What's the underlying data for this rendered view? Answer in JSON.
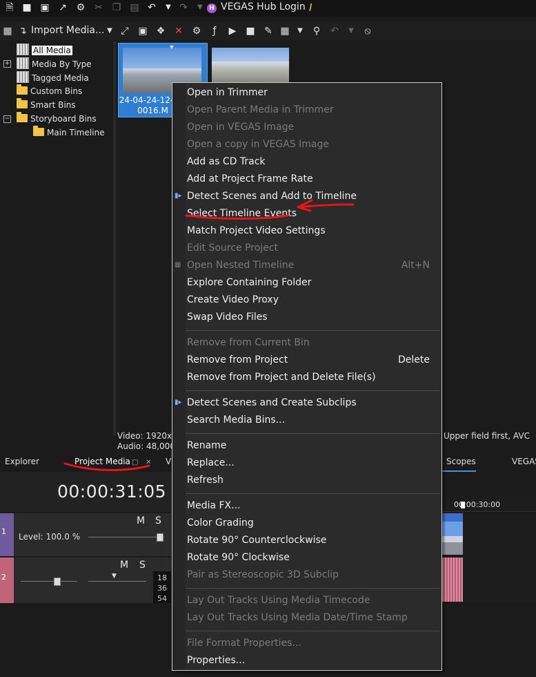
{
  "window": {
    "title": "VEGAS Hub Login",
    "hub_badge": "H",
    "title_icons": [
      "new-file-icon",
      "open-folder-icon",
      "save-icon",
      "external-icon",
      "gear-icon",
      "cut-icon",
      "copy-icon",
      "paste-icon",
      "undo-icon",
      "dropdown-icon",
      "redo-icon",
      "dropdown-icon"
    ]
  },
  "toolbar": {
    "import_label": "Import Media...",
    "icons": [
      "media-window-icon",
      "import-icon",
      "dropdown-icon",
      "trim-icon",
      "capture-icon",
      "proxy-icon",
      "delete-icon",
      "properties-icon",
      "fx-icon",
      "play-icon",
      "stop-icon",
      "auto-preview-icon",
      "views-icon",
      "search-icon",
      "undo-icon",
      "clear-icon"
    ]
  },
  "tree": {
    "items": [
      {
        "label": "All Media",
        "icon": "media-icon",
        "selected": true
      },
      {
        "label": "Media By Type",
        "icon": "media-icon",
        "expander": "+"
      },
      {
        "label": "Tagged Media",
        "icon": "media-icon"
      },
      {
        "label": "Custom Bins",
        "icon": "folder-icon"
      },
      {
        "label": "Smart Bins",
        "icon": "folder-icon"
      },
      {
        "label": "Storyboard Bins",
        "icon": "folder-icon",
        "expander": "−"
      },
      {
        "label": "Main Timeline",
        "icon": "folder-icon"
      }
    ]
  },
  "media": {
    "thumb1_label": "24-04-24-12-     0016.M",
    "info_video": "Video: 1920x1",
    "info_audio": "Audio: 48,000",
    "info_right": "Upper field first, AVC"
  },
  "tabs": {
    "explorer": "Explorer",
    "project_media": "Project Media",
    "v": "V",
    "scopes": "Scopes",
    "vegas": "VEGAS"
  },
  "timeline": {
    "timecode": "00:00:31:05",
    "ruler_time": "00:00:30:00",
    "track1_num": "1",
    "track1_level": "Level: 100.0 %",
    "track2_num": "2",
    "m": "M",
    "s": "S",
    "meter_labels": [
      "18",
      "36",
      "54"
    ]
  },
  "context_menu": {
    "groups": [
      [
        {
          "label": "Open in Trimmer",
          "enabled": true
        },
        {
          "label": "Open Parent Media in Trimmer",
          "enabled": false
        },
        {
          "label": "Open in VEGAS Image",
          "enabled": false
        },
        {
          "label": "Open a copy in VEGAS Image",
          "enabled": false
        },
        {
          "label": "Add as CD Track",
          "enabled": true
        },
        {
          "label": "Add at Project Frame Rate",
          "enabled": true
        },
        {
          "label": "Detect Scenes and Add to Timeline",
          "enabled": true,
          "icon": "scene-detect-icon"
        },
        {
          "label": "Select Timeline Events",
          "enabled": true
        },
        {
          "label": "Match Project Video Settings",
          "enabled": true
        },
        {
          "label": "Edit Source Project",
          "enabled": false
        },
        {
          "label": "Open Nested Timeline",
          "enabled": false,
          "shortcut": "Alt+N",
          "icon": "nested-timeline-icon"
        },
        {
          "label": "Explore Containing Folder",
          "enabled": true
        },
        {
          "label": "Create Video Proxy",
          "enabled": true
        },
        {
          "label": "Swap Video Files",
          "enabled": true
        }
      ],
      [
        {
          "label": "Remove from Current Bin",
          "enabled": false
        },
        {
          "label": "Remove from Project",
          "enabled": true,
          "shortcut": "Delete"
        },
        {
          "label": "Remove from Project and Delete File(s)",
          "enabled": true
        }
      ],
      [
        {
          "label": "Detect Scenes and Create Subclips",
          "enabled": true,
          "icon": "scene-detect-icon"
        },
        {
          "label": "Search Media Bins...",
          "enabled": true
        }
      ],
      [
        {
          "label": "Rename",
          "enabled": true
        },
        {
          "label": "Replace...",
          "enabled": true
        },
        {
          "label": "Refresh",
          "enabled": true
        }
      ],
      [
        {
          "label": "Media FX...",
          "enabled": true
        },
        {
          "label": "Color Grading",
          "enabled": true
        },
        {
          "label": "Rotate 90° Counterclockwise",
          "enabled": true
        },
        {
          "label": "Rotate 90° Clockwise",
          "enabled": true
        },
        {
          "label": "Pair as Stereoscopic 3D Subclip",
          "enabled": false
        }
      ],
      [
        {
          "label": "Lay Out Tracks Using Media Timecode",
          "enabled": false
        },
        {
          "label": "Lay Out Tracks Using Media Date/Time Stamp",
          "enabled": false
        }
      ],
      [
        {
          "label": "File Format Properties...",
          "enabled": false
        },
        {
          "label": "Properties...",
          "enabled": true
        }
      ]
    ]
  },
  "colors": {
    "annotation": "#e8141c",
    "selection": "#2e7fd3",
    "video_track": "#6f5b9c",
    "audio_track": "#c0647c"
  }
}
